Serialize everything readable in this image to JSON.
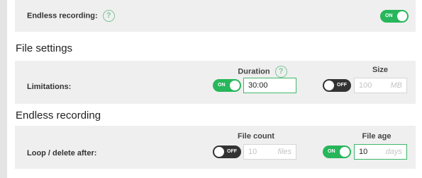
{
  "endless_toggle_row": {
    "label": "Endless recording:",
    "help": "?",
    "toggle": "ON"
  },
  "file_settings": {
    "title": "File settings",
    "limitations": {
      "label": "Limitations:",
      "duration": {
        "header": "Duration",
        "help": "?",
        "toggle": "ON",
        "value": "30:00",
        "unit": ""
      },
      "size": {
        "header": "Size",
        "toggle": "OFF",
        "value": "100",
        "unit": "MB"
      }
    }
  },
  "endless_recording": {
    "title": "Endless recording",
    "loop_delete": {
      "label": "Loop / delete after:",
      "file_count": {
        "header": "File count",
        "toggle": "OFF",
        "value": "10",
        "unit": "files"
      },
      "file_age": {
        "header": "File age",
        "toggle": "ON",
        "value": "10",
        "unit": "days"
      }
    }
  },
  "colors": {
    "accent": "#27b65b",
    "toggle_off": "#333333",
    "panel_bg": "#efefef",
    "help_icon": "#7ec79a"
  }
}
